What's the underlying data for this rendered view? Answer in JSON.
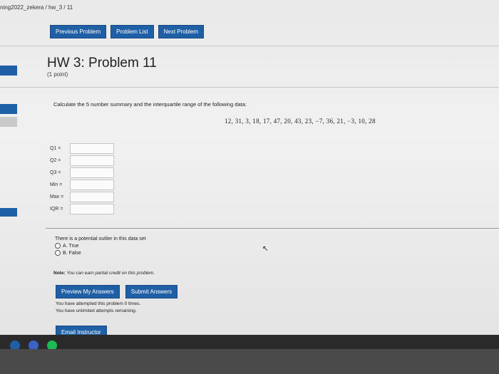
{
  "breadcrumb": "ning2022_zekera / hw_3 / 11",
  "nav": {
    "previous": "Previous Problem",
    "list": "Problem List",
    "next": "Next Problem"
  },
  "problem": {
    "title": "HW 3: Problem 11",
    "points": "(1 point)",
    "prompt": "Calculate the 5 number summary and the interquartile range of the following data:",
    "dataset": "12, 31, 3, 18, 17, 47, 20, 43, 23, −7, 36, 21, −3, 10, 28"
  },
  "fields": [
    {
      "label": "Q1 =",
      "value": ""
    },
    {
      "label": "Q2 =",
      "value": ""
    },
    {
      "label": "Q3 =",
      "value": ""
    },
    {
      "label": "Min =",
      "value": ""
    },
    {
      "label": "Max =",
      "value": ""
    },
    {
      "label": "IQR =",
      "value": ""
    }
  ],
  "outlier_question": {
    "text": "There is a potential outlier in this data set",
    "options": [
      "A. True",
      "B. False"
    ]
  },
  "note": {
    "label": "Note:",
    "text": "You can earn partial credit on this problem."
  },
  "actions": {
    "preview": "Preview My Answers",
    "submit": "Submit Answers"
  },
  "attempts": {
    "line1": "You have attempted this problem 0 times.",
    "line2": "You have unlimited attempts remaining."
  },
  "email": "Email Instructor",
  "colors": {
    "primary": "#1f5fa6"
  }
}
